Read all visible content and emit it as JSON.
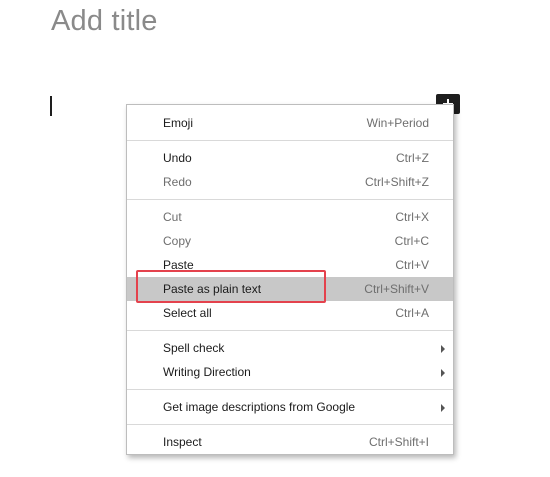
{
  "editor": {
    "title_placeholder": "Add title"
  },
  "add_block_button": {
    "icon": "plus-icon"
  },
  "context_menu": {
    "groups": [
      [
        {
          "label": "Emoji",
          "shortcut": "Win+Period",
          "disabled": false,
          "submenu": false
        }
      ],
      [
        {
          "label": "Undo",
          "shortcut": "Ctrl+Z",
          "disabled": false,
          "submenu": false
        },
        {
          "label": "Redo",
          "shortcut": "Ctrl+Shift+Z",
          "disabled": true,
          "submenu": false
        }
      ],
      [
        {
          "label": "Cut",
          "shortcut": "Ctrl+X",
          "disabled": true,
          "submenu": false
        },
        {
          "label": "Copy",
          "shortcut": "Ctrl+C",
          "disabled": true,
          "submenu": false
        },
        {
          "label": "Paste",
          "shortcut": "Ctrl+V",
          "disabled": false,
          "submenu": false
        },
        {
          "label": "Paste as plain text",
          "shortcut": "Ctrl+Shift+V",
          "disabled": false,
          "submenu": false,
          "highlighted": true
        },
        {
          "label": "Select all",
          "shortcut": "Ctrl+A",
          "disabled": false,
          "submenu": false
        }
      ],
      [
        {
          "label": "Spell check",
          "shortcut": "",
          "disabled": false,
          "submenu": true
        },
        {
          "label": "Writing Direction",
          "shortcut": "",
          "disabled": false,
          "submenu": true
        }
      ],
      [
        {
          "label": "Get image descriptions from Google",
          "shortcut": "",
          "disabled": false,
          "submenu": true
        }
      ],
      [
        {
          "label": "Inspect",
          "shortcut": "Ctrl+Shift+I",
          "disabled": false,
          "submenu": false
        }
      ]
    ]
  },
  "colors": {
    "annotation_outline": "#e4424d",
    "highlight_bg": "#c8c8c8",
    "disabled_text": "#6e6e6e"
  }
}
